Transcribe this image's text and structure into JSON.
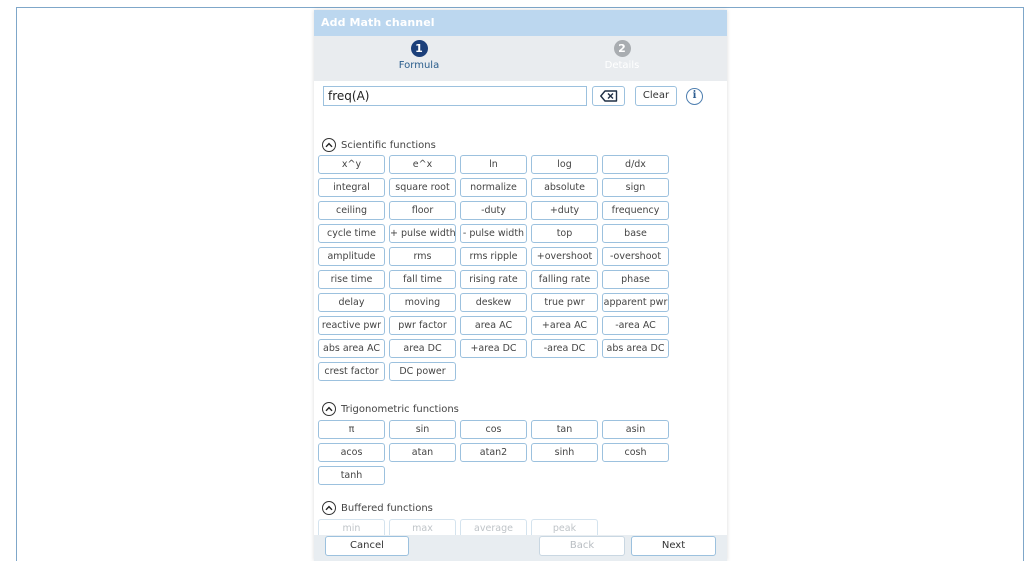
{
  "dialog": {
    "title": "Add Math channel"
  },
  "steps": [
    {
      "number": "1",
      "label": "Formula"
    },
    {
      "number": "2",
      "label": "Details"
    }
  ],
  "formula": {
    "value": "freq(A)",
    "clear_label": "Clear",
    "info_glyph": "i"
  },
  "sections": [
    {
      "title": "Scientific functions",
      "buttons": [
        "x^y",
        "e^x",
        "ln",
        "log",
        "d/dx",
        "integral",
        "square root",
        "normalize",
        "absolute",
        "sign",
        "ceiling",
        "floor",
        "-duty",
        "+duty",
        "frequency",
        "cycle time",
        "+ pulse width",
        "- pulse width",
        "top",
        "base",
        "amplitude",
        "rms",
        "rms ripple",
        "+overshoot",
        "-overshoot",
        "rise time",
        "fall time",
        "rising rate",
        "falling rate",
        "phase",
        "delay",
        "moving",
        "deskew",
        "true pwr",
        "apparent pwr",
        "reactive pwr",
        "pwr factor",
        "area AC",
        "+area AC",
        "-area AC",
        "abs area AC",
        "area DC",
        "+area DC",
        "-area DC",
        "abs area DC",
        "crest factor",
        "DC power"
      ]
    },
    {
      "title": "Trigonometric functions",
      "buttons": [
        "π",
        "sin",
        "cos",
        "tan",
        "asin",
        "acos",
        "atan",
        "atan2",
        "sinh",
        "cosh",
        "tanh"
      ]
    },
    {
      "title": "Buffered functions",
      "buttons": [
        "min",
        "max",
        "average",
        "peak"
      ]
    }
  ],
  "footer": {
    "cancel": "Cancel",
    "back": "Back",
    "next": "Next"
  },
  "colors": {
    "titlebar": "#bcd7ef",
    "step_active": "#1b3f7a",
    "step_inactive": "#a9adb1",
    "button_border": "#9cc1de"
  },
  "icons": {
    "backspace": "backspace-icon",
    "collapse": "chevron-up-icon",
    "info": "info-icon"
  }
}
